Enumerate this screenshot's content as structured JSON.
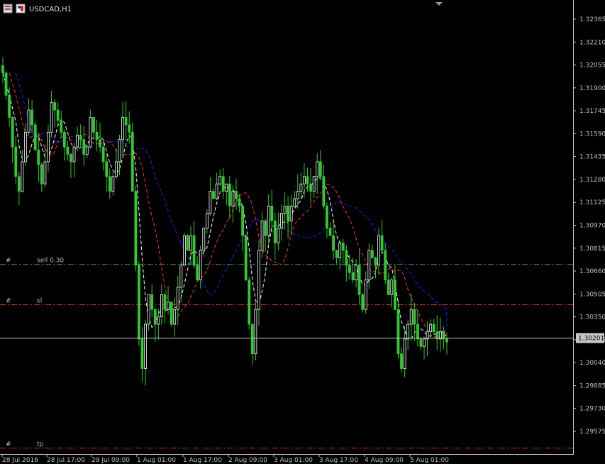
{
  "window": {
    "title": "USDCAD,H1",
    "icons": [
      "chart-window-icon",
      "flag-icon"
    ]
  },
  "chart_data": {
    "type": "candlestick",
    "symbol": "USDCAD",
    "timeframe": "H1",
    "ylim": [
      1.295,
      1.3245
    ],
    "y_ticks": [
      "1.32365",
      "1.32210",
      "1.32055",
      "1.31900",
      "1.31745",
      "1.31590",
      "1.31435",
      "1.31280",
      "1.31125",
      "1.30970",
      "1.30815",
      "1.30660",
      "1.30505",
      "1.30350",
      "1.30195",
      "1.30040",
      "1.29885",
      "1.29730",
      "1.29575"
    ],
    "x_ticks": [
      "28 Jul 2016",
      "28 Jul 17:00",
      "29 Jul 09:00",
      "1 Aug 01:00",
      "1 Aug 17:00",
      "2 Aug 09:00",
      "3 Aug 01:00",
      "3 Aug 17:00",
      "4 Aug 09:00",
      "5 Aug 01:00"
    ],
    "current_price": "1.30201",
    "candle_colors": {
      "bull": "#ffffff",
      "bear": "#2ecc2e"
    },
    "moving_averages": [
      {
        "color": "#ffffff",
        "style": "dashed"
      },
      {
        "color": "#ff3030",
        "style": "dashed"
      },
      {
        "color": "#2020ff",
        "style": "dashed"
      }
    ],
    "levels": [
      {
        "marker": "#",
        "label": "sell 0.30",
        "price": 1.3068,
        "color": "#2e8b2e"
      },
      {
        "marker": "#",
        "label": "sl",
        "price": 1.3043,
        "color": "#e03020"
      },
      {
        "marker": "#",
        "label": "tp",
        "price": 1.295,
        "color": "#e03020"
      }
    ],
    "closes": [
      1.32,
      1.3185,
      1.317,
      1.315,
      1.313,
      1.312,
      1.314,
      1.316,
      1.3175,
      1.3165,
      1.3148,
      1.3138,
      1.3125,
      1.314,
      1.316,
      1.318,
      1.3175,
      1.3168,
      1.316,
      1.315,
      1.3145,
      1.314,
      1.315,
      1.3158,
      1.3155,
      1.3145,
      1.315,
      1.317,
      1.316,
      1.3155,
      1.315,
      1.314,
      1.313,
      1.312,
      1.313,
      1.314,
      1.3155,
      1.317,
      1.3165,
      1.316,
      1.312,
      1.307,
      1.302,
      1.3,
      1.303,
      1.305,
      1.304,
      1.303,
      1.3035,
      1.305,
      1.304,
      1.3045,
      1.303,
      1.304,
      1.3055,
      1.307,
      1.309,
      1.308,
      1.309,
      1.307,
      1.306,
      1.308,
      1.3095,
      1.3105,
      1.312,
      1.3115,
      1.3125,
      1.313,
      1.312,
      1.3125,
      1.311,
      1.312,
      1.3115,
      1.311,
      1.309,
      1.306,
      1.303,
      1.301,
      1.304,
      1.308,
      1.31,
      1.309,
      1.311,
      1.31,
      1.3085,
      1.3095,
      1.3105,
      1.311,
      1.31,
      1.311,
      1.3115,
      1.312,
      1.3125,
      1.313,
      1.3125,
      1.312,
      1.313,
      1.314,
      1.313,
      1.311,
      1.3095,
      1.309,
      1.308,
      1.3075,
      1.3085,
      1.308,
      1.307,
      1.3065,
      1.306,
      1.307,
      1.305,
      1.304,
      1.306,
      1.308,
      1.3075,
      1.307,
      1.309,
      1.308,
      1.306,
      1.305,
      1.306,
      1.304,
      1.301,
      1.3,
      1.302,
      1.303,
      1.304,
      1.303,
      1.302,
      1.3015,
      1.302,
      1.3025,
      1.303,
      1.3025,
      1.302,
      1.3025,
      1.302,
      1.3018
    ]
  }
}
